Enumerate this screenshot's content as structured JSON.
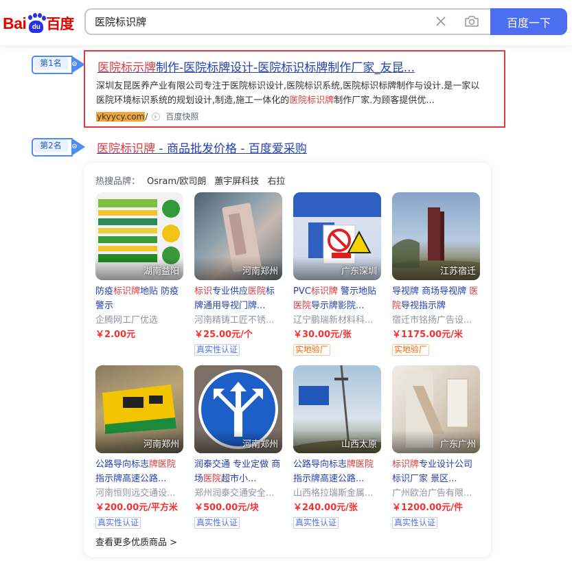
{
  "search": {
    "query": "医院标识牌",
    "button_label": "百度一下"
  },
  "logo": {
    "bai": "Bai",
    "du": "du",
    "cn": "百度"
  },
  "result1": {
    "rank": "第1名",
    "title_hl": "医院标示牌",
    "title_rest": "制作-医院标牌设计-医院标识标牌制作厂家_友昆...",
    "abstract_line1": "深圳友昆医养产业有限公司专注于医院标识设计,医院标识系统,医院标识标牌制作与设计.是一家以",
    "abstract_line2_a": "医院环境标识系统的规划设计,制造,施工一体化的",
    "abstract_line2_hl": "医院标识牌",
    "abstract_line2_b": "制作厂家.为顾客提供优...",
    "url": "ykyycy.com",
    "url_suffix": "/",
    "kuaizhao": "百度快照"
  },
  "result2": {
    "rank": "第2名",
    "title_hl": "医院标识牌",
    "title_rest": " - 商品批发价格 - 百度爱采购",
    "hot_label": "热搜品牌：",
    "brands": [
      "Osram/欧司朗",
      "蕙宇屏科技",
      "右拉"
    ],
    "more": "查看更多优质商品 >",
    "products": [
      {
        "loc": "湖南益阳",
        "name_a": "防疫",
        "name_hl": "标识牌",
        "name_b": "地贴 防疫警示",
        "shop": "企腾网工厂优选",
        "price": "￥2.00元",
        "tag": ""
      },
      {
        "loc": "河南郑州",
        "name_a": "",
        "name_hl": "标识",
        "name_b": "专业供应",
        "name_hl2": "医院",
        "name_c": "标牌通用导视门牌...",
        "shop": "河南精铸工匠不锈...",
        "price": "￥25.00元/个",
        "tag": "真实性认证",
        "tag_color": "blue"
      },
      {
        "loc": "广东深圳",
        "name_a": "PVC",
        "name_hl": "标识牌",
        "name_b": " 警示地贴 ",
        "name_hl2": "医院",
        "name_c": "导示牌影院...",
        "shop": "辽宁鹏瑞新材料科...",
        "price": "￥30.00元/张",
        "tag": "实地验厂",
        "tag_color": "orange"
      },
      {
        "loc": "江苏宿迁",
        "name_a": "导视牌 商场导视牌 ",
        "name_hl": "医院",
        "name_b": "导视指示牌",
        "shop": "宿迁市铭扬广告设...",
        "price": "￥1175.00元/米",
        "tag": "实地验厂",
        "tag_color": "orange"
      },
      {
        "loc": "河南郑州",
        "name_a": "公路导向标志",
        "name_hl": "牌医院",
        "name_b": "指示牌高速公路...",
        "shop": "河南恒则远交通设...",
        "price": "￥200.00元/平方米",
        "tag": "真实性认证",
        "tag_color": "blue"
      },
      {
        "loc": "河南郑州",
        "name_a": "润泰交通 专业定做 商场",
        "name_hl": "医院",
        "name_b": "超市小...",
        "shop": "郑州润泰交通安全...",
        "price": "￥500.00元/块",
        "tag": "真实性认证",
        "tag_color": "blue"
      },
      {
        "loc": "山西太原",
        "name_a": "公路导向标志",
        "name_hl": "牌医院",
        "name_b": "指示牌高速公路...",
        "shop": "山西格拉瑞斯金属...",
        "price": "￥240.00元/张",
        "tag": "真实性认证",
        "tag_color": "blue"
      },
      {
        "loc": "广东广州",
        "name_a": "",
        "name_hl": "标识牌",
        "name_b": "专业设计公司 标识厂家 景区...",
        "shop": "广州欧治广告有限...",
        "price": "￥1200.00元/件",
        "tag": "真实性认证",
        "tag_color": "blue"
      }
    ]
  },
  "colors": {
    "accent": "#4e6ef2",
    "highlight": "#e0393e",
    "link": "#2440b3",
    "price": "#f73131"
  }
}
